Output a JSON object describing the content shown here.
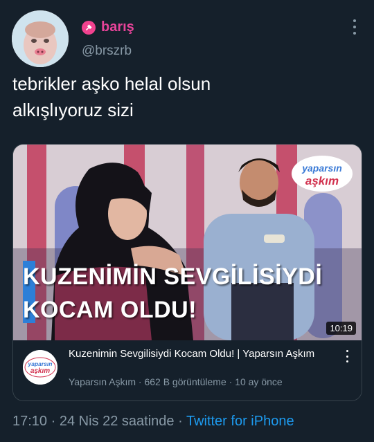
{
  "user": {
    "display_name": "barış",
    "handle": "@brszrb"
  },
  "tweet": {
    "text_line1": "tebrikler aşko helal olsun",
    "text_line2": "alkışlıyoruz sizi"
  },
  "card": {
    "thumbnail": {
      "headline_line1": "KUZENİMİN SEVGİLİSİYDİ",
      "headline_line2": "KOCAM OLDU!",
      "duration": "10:19",
      "brand_logo_top": "yaparsın",
      "brand_logo_bottom": "aşkım"
    },
    "channel_logo_top": "yaparsın",
    "channel_logo_bottom": "aşkım",
    "video_title": "Kuzenimin Sevgilisiydi Kocam Oldu! | Yaparsın Aşkım",
    "video_meta": "Yaparsın Aşkım · 662 B görüntüleme · 10 ay önce"
  },
  "footer": {
    "time": "17:10",
    "sep1": " · ",
    "date": "24 Nis 22 saatinde",
    "sep2": " · ",
    "source": "Twitter for iPhone"
  },
  "colors": {
    "background": "#15202b",
    "name_pink": "#e8449a",
    "muted": "#8899a6",
    "link_blue": "#1d9bf0"
  },
  "icons": [
    "pin-icon",
    "more-vertical-icon",
    "card-more-icon"
  ]
}
